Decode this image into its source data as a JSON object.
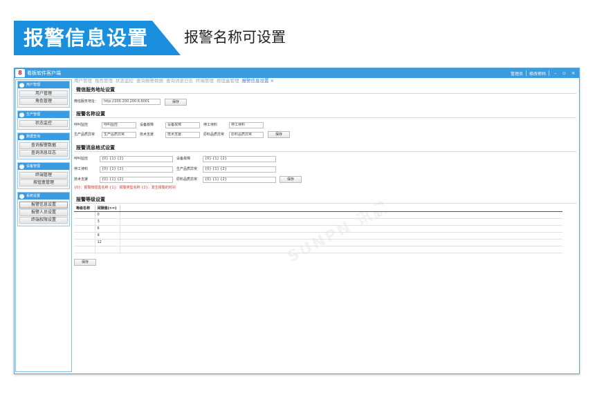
{
  "banner": {
    "title": "报警信息设置",
    "subtitle": "报警名称可设置"
  },
  "window": {
    "logo": "8",
    "title": "看板软件客户端",
    "links": [
      "管理员",
      "修改密码"
    ],
    "controls": {
      "minimize": "–",
      "restore": "▫",
      "close": "×"
    }
  },
  "sidebar": {
    "groups": [
      {
        "label": "用户管理",
        "items": [
          "用户管理",
          "角色管理"
        ]
      },
      {
        "label": "生产管理",
        "items": [
          "状态监控"
        ]
      },
      {
        "label": "数据查询",
        "items": [
          "查询报警数据",
          "查询消息日志"
        ]
      },
      {
        "label": "设备管理",
        "items": [
          "终端管理",
          "按钮盒管理"
        ]
      },
      {
        "label": "系统设置",
        "items": [
          "报警信息设置",
          "报警人员设置",
          "终端权限设置"
        ],
        "active": "报警信息设置"
      }
    ]
  },
  "tabs": [
    "用户管理",
    "角色管理",
    "状态监控",
    "查询报警数据",
    "查询消息日志",
    "终端管理",
    "按钮盒管理",
    "报警信息设置 ×"
  ],
  "active_tab": "报警信息设置 ×",
  "wechat": {
    "title": "微信服务地址设置",
    "label": "微信服务地址：",
    "value": "http://200.200.200.6:6001",
    "save": "保存"
  },
  "alarm_names": {
    "title": "报警名称设置",
    "rows": [
      [
        {
          "label": "呼叫监控",
          "value": "呼叫监控"
        },
        {
          "label": "设备故障",
          "value": "设备故障"
        },
        {
          "label": "停工待料",
          "value": "停工待料"
        }
      ],
      [
        {
          "label": "生产品质异常",
          "value": "生产品质异常"
        },
        {
          "label": "技术支援",
          "value": "技术支援"
        },
        {
          "label": "原料品质异常",
          "value": "原料品质异常"
        }
      ]
    ],
    "save": "保存"
  },
  "alarm_format": {
    "title": "报警消息格式设置",
    "rows": [
      [
        {
          "label": "呼叫监控",
          "value": "{0} {1} {2}"
        },
        {
          "label": "设备故障",
          "value": "{0} {1} {2}"
        }
      ],
      [
        {
          "label": "停工待料",
          "value": "{0} {1} {2}"
        },
        {
          "label": "生产品质异常",
          "value": "{0} {1} {2}"
        }
      ],
      [
        {
          "label": "技术支援",
          "value": "{0} {1} {2}"
        },
        {
          "label": "原料品质异常",
          "value": "{0} {1} {2}"
        }
      ]
    ],
    "save": "保存",
    "hint": "{0}：报警按钮盒名称 {1}：报警类型名称 {2}：发生报警的时间"
  },
  "alarm_levels": {
    "title": "报警等级设置",
    "columns": [
      "等级名称",
      "间隔值(>=)"
    ],
    "rows": [
      [
        "",
        "0"
      ],
      [
        "",
        "3"
      ],
      [
        "",
        "6"
      ],
      [
        "",
        "9"
      ],
      [
        "",
        "12"
      ],
      [
        "",
        ""
      ]
    ],
    "save": "保存"
  },
  "watermark": "SUNPN 讯鹏",
  "colors": {
    "accent": "#1a8fdd",
    "titlebar": "#3b9be0",
    "hint": "#e0302a"
  }
}
